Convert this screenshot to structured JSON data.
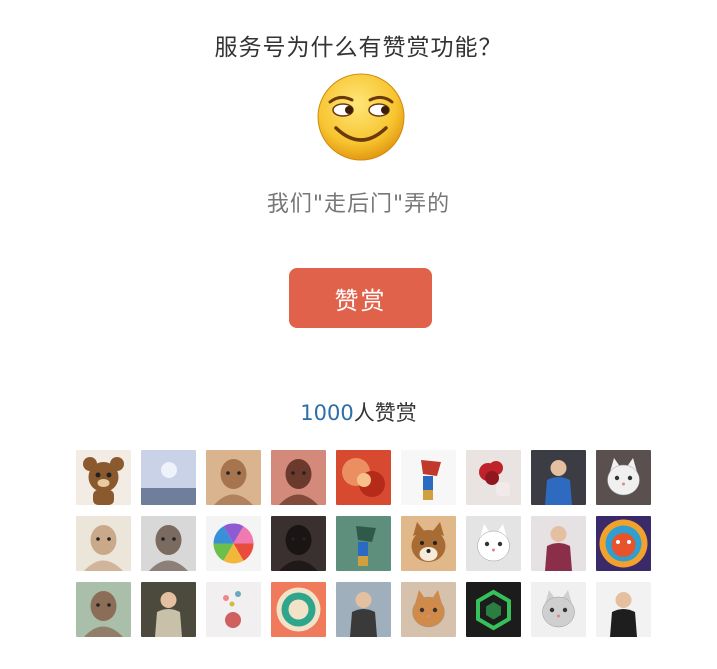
{
  "question": "服务号为什么有赞赏功能？",
  "subtitle": "我们\"走后门\"弄的",
  "reward_button_label": "赞赏",
  "reward_count": {
    "number": "1000",
    "suffix": "人赞赏"
  },
  "emoji_icon": "smirk-face-icon",
  "colors": {
    "button": "#e0624a",
    "count_number": "#2c6ea8"
  },
  "avatars": [
    {
      "name": "avatar-bear",
      "bg": "#f3ece4",
      "fg": "#8a5a2e",
      "shape": "bear"
    },
    {
      "name": "avatar-sky",
      "bg": "#c9d2e6",
      "fg": "#6f7e9a",
      "shape": "sky"
    },
    {
      "name": "avatar-child",
      "bg": "#d9b48f",
      "fg": "#a77450",
      "shape": "face"
    },
    {
      "name": "avatar-girl-selfie",
      "bg": "#d48a7a",
      "fg": "#6b3a2c",
      "shape": "face"
    },
    {
      "name": "avatar-red-art",
      "bg": "#d84a2f",
      "fg": "#f0a070",
      "shape": "blob"
    },
    {
      "name": "avatar-figurine",
      "bg": "#f7f7f7",
      "fg": "#c0392b",
      "shape": "figure"
    },
    {
      "name": "avatar-red-flower",
      "bg": "#e9e3e1",
      "fg": "#c0222a",
      "shape": "flower"
    },
    {
      "name": "avatar-boy-blue",
      "bg": "#3c3c44",
      "fg": "#2d6ac0",
      "shape": "person"
    },
    {
      "name": "avatar-cat-hat",
      "bg": "#5a5050",
      "fg": "#f0f0f0",
      "shape": "cat"
    },
    {
      "name": "avatar-woman-light",
      "bg": "#ece6da",
      "fg": "#c9a98a",
      "shape": "face"
    },
    {
      "name": "avatar-man-glasses",
      "bg": "#d8d8d8",
      "fg": "#7a6a60",
      "shape": "face"
    },
    {
      "name": "avatar-color-wheel",
      "bg": "#f4f4f4",
      "fg": "#f2b73a",
      "shape": "wheel"
    },
    {
      "name": "avatar-woman-dark",
      "bg": "#3a3030",
      "fg": "#1a1414",
      "shape": "face"
    },
    {
      "name": "avatar-green-scene",
      "bg": "#5e8f7c",
      "fg": "#2f5a4a",
      "shape": "figure"
    },
    {
      "name": "avatar-shiba",
      "bg": "#e0b88a",
      "fg": "#a86b34",
      "shape": "dog"
    },
    {
      "name": "avatar-white-cat",
      "bg": "#e4e4e4",
      "fg": "#ffffff",
      "shape": "cat"
    },
    {
      "name": "avatar-dancer",
      "bg": "#e6e2e4",
      "fg": "#8a2e4a",
      "shape": "person"
    },
    {
      "name": "avatar-lion-art",
      "bg": "#3a2a6a",
      "fg": "#e8532c",
      "shape": "lion"
    },
    {
      "name": "avatar-man-outdoor",
      "bg": "#a9bfa9",
      "fg": "#8c6e58",
      "shape": "face"
    },
    {
      "name": "avatar-man-road",
      "bg": "#4c4a3c",
      "fg": "#c8c0a8",
      "shape": "person"
    },
    {
      "name": "avatar-balloons",
      "bg": "#f1efef",
      "fg": "#d06060",
      "shape": "balloon"
    },
    {
      "name": "avatar-target",
      "bg": "#f07a5c",
      "fg": "#2fa58c",
      "shape": "target"
    },
    {
      "name": "avatar-child-lake",
      "bg": "#9fb0bc",
      "fg": "#3a3a3a",
      "shape": "person"
    },
    {
      "name": "avatar-cat-orange",
      "bg": "#d6c2ac",
      "fg": "#d08a4a",
      "shape": "cat"
    },
    {
      "name": "avatar-green-logo",
      "bg": "#1c1c1c",
      "fg": "#36c05a",
      "shape": "hex"
    },
    {
      "name": "avatar-cat-bowtie",
      "bg": "#f0f0f0",
      "fg": "#cfcfcf",
      "shape": "cat"
    },
    {
      "name": "avatar-man-suit",
      "bg": "#f2f2f2",
      "fg": "#1e1e1e",
      "shape": "person"
    }
  ]
}
